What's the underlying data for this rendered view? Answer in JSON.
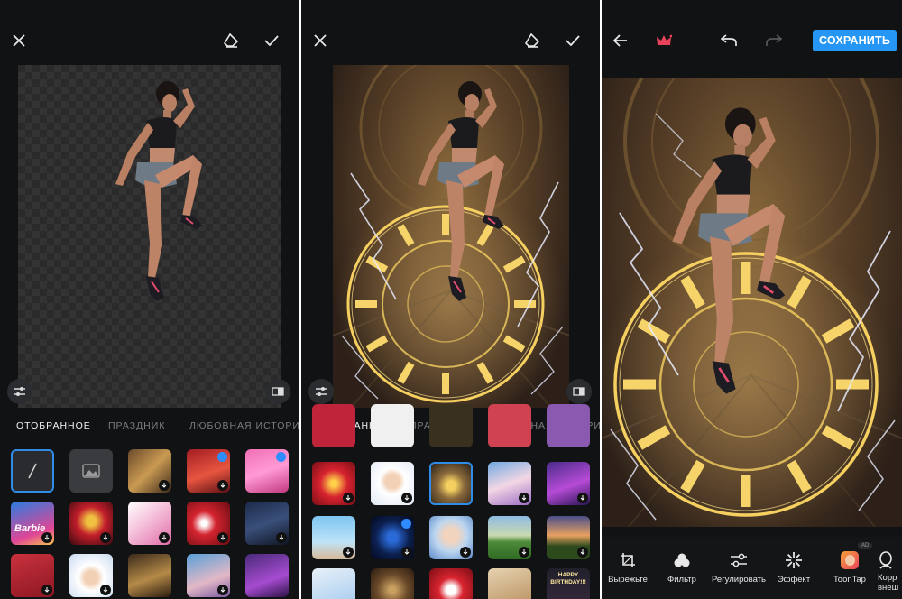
{
  "editor": {
    "tabs": [
      "ОТОБРАННОЕ",
      "ПРАЗДНИК",
      "ЛЮБОВНАЯ ИСТОРИЯ"
    ],
    "active_tab": "ОТОБРАННОЕ"
  },
  "panel1": {
    "thumbnails_row2": [
      "Barbie"
    ]
  },
  "panel2": {
    "thumbnail_text": "HAPPY BIRTHDAY!!!"
  },
  "panel3": {
    "save_label": "СОХРАНИТЬ",
    "tools": [
      "Вырежьте",
      "Фильтр",
      "Регулировать",
      "Эффект",
      "ToonTap",
      "Корр внеш"
    ],
    "ad_badge": "AD"
  },
  "colors": {
    "background": "#111214",
    "accent": "#2596f3",
    "crown": "#e8435a",
    "clock_glow": "#f5d060"
  }
}
